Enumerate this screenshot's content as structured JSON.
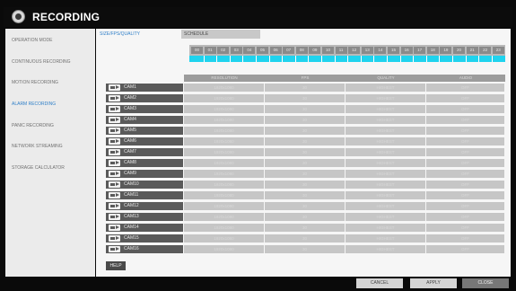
{
  "title": "RECORDING",
  "sidebar": {
    "items": [
      {
        "label": "OPERATION MODE",
        "active": false
      },
      {
        "label": "CONTINUOUS RECORDING",
        "active": false
      },
      {
        "label": "MOTION RECORDING",
        "active": false
      },
      {
        "label": "ALARM RECORDING",
        "active": true
      },
      {
        "label": "PANIC RECORDING",
        "active": false
      },
      {
        "label": "NETWORK STREAMING",
        "active": false
      },
      {
        "label": "STORAGE CALCULATOR",
        "active": false
      }
    ]
  },
  "tabs": {
    "size_fps_quality": "SIZE/FPS/QUALITY",
    "schedule": "SCHEDULE"
  },
  "hours": [
    "00",
    "01",
    "02",
    "03",
    "04",
    "05",
    "06",
    "07",
    "08",
    "09",
    "10",
    "11",
    "12",
    "13",
    "14",
    "15",
    "16",
    "17",
    "18",
    "19",
    "20",
    "21",
    "22",
    "23"
  ],
  "schedule_color": "#1fd3ee",
  "table": {
    "headers": {
      "resolution": "RESOLUTION",
      "fps": "FPS",
      "quality": "QUALITY",
      "audio": "AUDIO"
    },
    "rows": [
      {
        "camera": "CAM1",
        "resolution": "1920x1080",
        "fps": "30",
        "quality": "HIGHEST",
        "audio": "OFF"
      },
      {
        "camera": "CAM2",
        "resolution": "1920x1080",
        "fps": "30",
        "quality": "HIGHEST",
        "audio": "OFF"
      },
      {
        "camera": "CAM3",
        "resolution": "1920x1080",
        "fps": "30",
        "quality": "HIGHEST",
        "audio": "OFF"
      },
      {
        "camera": "CAM4",
        "resolution": "1920x1080",
        "fps": "30",
        "quality": "HIGHEST",
        "audio": "OFF"
      },
      {
        "camera": "CAM5",
        "resolution": "1920x1080",
        "fps": "30",
        "quality": "HIGHEST",
        "audio": "OFF"
      },
      {
        "camera": "CAM6",
        "resolution": "1920x1080",
        "fps": "30",
        "quality": "HIGHEST",
        "audio": "OFF"
      },
      {
        "camera": "CAM7",
        "resolution": "1920x1080",
        "fps": "30",
        "quality": "HIGHEST",
        "audio": "OFF"
      },
      {
        "camera": "CAM8",
        "resolution": "1920x1080",
        "fps": "30",
        "quality": "HIGHEST",
        "audio": "OFF"
      },
      {
        "camera": "CAM9",
        "resolution": "1920x1080",
        "fps": "30",
        "quality": "HIGHEST",
        "audio": "OFF"
      },
      {
        "camera": "CAM10",
        "resolution": "1920x1080",
        "fps": "30",
        "quality": "HIGHEST",
        "audio": "OFF"
      },
      {
        "camera": "CAM11",
        "resolution": "1920x1080",
        "fps": "30",
        "quality": "HIGHEST",
        "audio": "OFF"
      },
      {
        "camera": "CAM12",
        "resolution": "1920x1080",
        "fps": "30",
        "quality": "HIGHEST",
        "audio": "OFF"
      },
      {
        "camera": "CAM13",
        "resolution": "1920x1080",
        "fps": "30",
        "quality": "HIGHEST",
        "audio": "OFF"
      },
      {
        "camera": "CAM14",
        "resolution": "1920x1080",
        "fps": "30",
        "quality": "HIGHEST",
        "audio": "OFF"
      },
      {
        "camera": "CAM15",
        "resolution": "1920x1080",
        "fps": "30",
        "quality": "HIGHEST",
        "audio": "OFF"
      },
      {
        "camera": "CAM16",
        "resolution": "1920x1080",
        "fps": "30",
        "quality": "HIGHEST",
        "audio": "OFF"
      }
    ]
  },
  "buttons": {
    "help": "HELP",
    "cancel": "CANCEL",
    "apply": "APPLY",
    "close": "CLOSE"
  },
  "icons": {
    "title": "settings-disc-icon",
    "camera": "camera-icon"
  }
}
